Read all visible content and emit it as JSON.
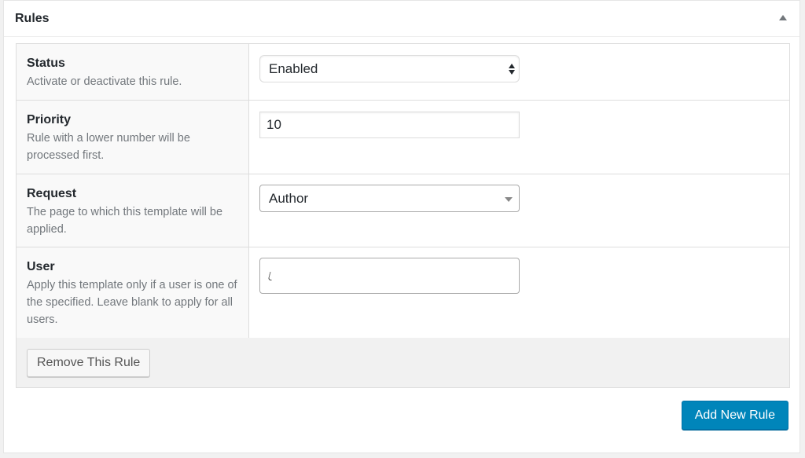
{
  "panel": {
    "title": "Rules",
    "toggle_icon": "triangle-up-icon"
  },
  "rules": [
    {
      "label": "Status",
      "description": "Activate or deactivate this rule.",
      "control": "select",
      "value": "Enabled"
    },
    {
      "label": "Priority",
      "description": "Rule with a lower number will be processed first.",
      "control": "text",
      "value": "10"
    },
    {
      "label": "Request",
      "description": "The page to which this template will be applied.",
      "control": "dropdown",
      "value": "Author"
    },
    {
      "label": "User",
      "description": "Apply this template only if a user is one of the specified. Leave blank to apply for all users.",
      "control": "multiselect",
      "value": ""
    }
  ],
  "actions": {
    "remove_label": "Remove This Rule",
    "add_label": "Add New Rule"
  },
  "colors": {
    "primary": "#0085ba",
    "label_bg": "#f9f9f9",
    "muted_text": "#72777c"
  }
}
